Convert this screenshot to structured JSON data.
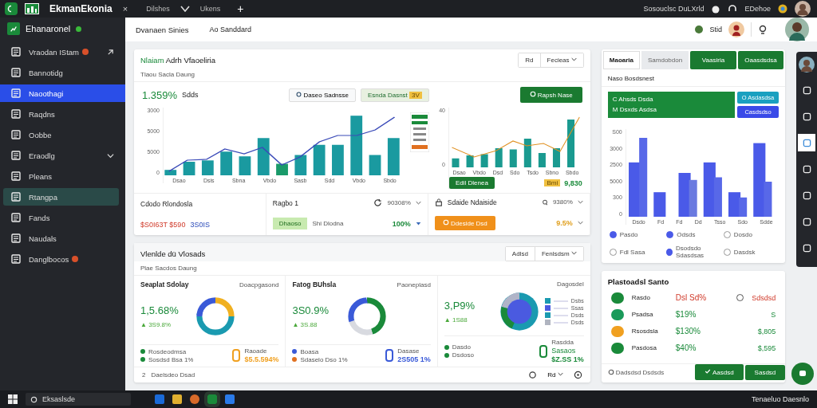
{
  "titlebar": {
    "tabs": [
      {
        "label": "EkmanEkonia",
        "selected": true
      },
      {
        "label": "Dilshes",
        "selected": false
      },
      {
        "label": "Ukens",
        "selected": false
      }
    ],
    "close": "×",
    "new_tab": "+",
    "status": "Sosouclsc DuLXrld",
    "user": "EDehoe"
  },
  "sidebar": {
    "title": "Ehanaronel",
    "items": [
      {
        "label": "Vraodan IStam",
        "badge": true,
        "link": true,
        "selected": false,
        "highlighted": false
      },
      {
        "label": "Bannotidg",
        "badge": false,
        "selected": false,
        "highlighted": false
      },
      {
        "label": "Naoothagi",
        "badge": false,
        "selected": true,
        "highlighted": false
      },
      {
        "label": "Raqdns",
        "badge": false,
        "selected": false,
        "highlighted": false
      },
      {
        "label": "Oobbe",
        "badge": false,
        "selected": false,
        "highlighted": false
      },
      {
        "label": "Eraodlg",
        "badge": false,
        "submenu": true,
        "selected": false,
        "highlighted": false
      },
      {
        "label": "Pleans",
        "badge": false,
        "selected": false,
        "highlighted": false
      },
      {
        "label": "Rtangpa",
        "badge": false,
        "selected": false,
        "highlighted": true
      },
      {
        "label": "Fands",
        "badge": false,
        "selected": false,
        "highlighted": false
      },
      {
        "label": "Naudals",
        "badge": false,
        "selected": false,
        "highlighted": false
      },
      {
        "label": "Danglbocos",
        "badge": true,
        "selected": false,
        "highlighted": false
      }
    ]
  },
  "header": {
    "title": "Dvanaen Sinies",
    "subtitle": "Ao Sanddard",
    "user": "Stid"
  },
  "overview": {
    "title_accent": "Nlaiam",
    "title": "Adrh Vfaoeliria",
    "subtitle": "Tlaou Sacla Daung",
    "filter": "Rd",
    "dropdown": "Fecieas",
    "stat": "1.359%",
    "stat_label": "Sdds",
    "chip_1": "Daseo Sadnsse",
    "chip_2": "Esnda Dasnst",
    "chip_2_tag": "3V",
    "action": "Rapsh Nase",
    "left_chart": {
      "y_labels": [
        "3000",
        "5000",
        "5000",
        "0"
      ],
      "x_labels": [
        "Dsao",
        "Dsis",
        "Sbna",
        "Vbdo",
        "Sasb",
        "Sdd",
        "Vbdo",
        "Sbdo"
      ]
    },
    "right_chart": {
      "y_labels": [
        "40",
        "0"
      ],
      "x_labels": [
        "Dsao",
        "Vbdo",
        "Dsd",
        "Sdo",
        "Tsdo",
        "Sbno",
        "Sbdo"
      ]
    },
    "chart_button": "Edil Dlenea",
    "chart_tag": "Bmi",
    "chart_total": "9,830",
    "cells": [
      {
        "title": "Cdodo Rlondosla",
        "value_1": "$S0I63T $590",
        "value_2": "3S0IS"
      },
      {
        "title": "Ragbo 1",
        "reading": "90308%",
        "chip": "Dhaoso",
        "note": "Shi Dlodna",
        "value": "100%"
      },
      {
        "title": "Sdaide Ndaiside",
        "reading": "9380%",
        "button": "Ddeside Dsd",
        "value": "9.5%"
      }
    ]
  },
  "breakdown": {
    "title": "Vlenlde dü Vlosads",
    "filter": "Adlsd",
    "dropdown": "Fenlsdsm",
    "subtitle": "Plae Sacdos Daung",
    "panels": [
      {
        "kind": "donut",
        "title": "Seaplat Sdolay",
        "note": "Doacpgasond",
        "value": "1,5.68%",
        "change": "▲ 3S9.8%",
        "legend": [
          {
            "label": "Rosdeodmsa",
            "color": "#1a8a3a"
          },
          {
            "label": "Sosdsd Bsa 1%",
            "color": "#1a8a3a"
          }
        ],
        "indicator": {
          "label": "Raoade",
          "value": "$5.5.594%",
          "color": "#f0a020"
        }
      },
      {
        "kind": "ring",
        "title": "Fatog BUhsla",
        "note": "Paoneplasd",
        "value": "3S0.9%",
        "change": "▲ 3S.88",
        "legend": [
          {
            "label": "Boasa",
            "color": "#3a5ad8"
          },
          {
            "label": "Sdaselo Dso 1%",
            "color": "#e07020"
          }
        ],
        "indicator": {
          "label": "Dasase",
          "value": "2S505 1%",
          "color": "#3a5ad8"
        }
      },
      {
        "kind": "pie",
        "note": "Dagosdel",
        "value": "3,P9%",
        "change": "▲ 1S88",
        "keys": [
          {
            "label": "Dsbs",
            "color": "#1a9ab0"
          },
          {
            "label": "Ssas",
            "color": "#4a5ae0"
          },
          {
            "label": "Dsds",
            "color": "#1a9ab0"
          },
          {
            "label": "Dsds",
            "color": "#b0b4c0"
          }
        ],
        "legend": [
          {
            "label": "Dasdo",
            "color": "#1a8a3a"
          },
          {
            "label": "Dsdoso",
            "color": "#1a8a3a"
          }
        ],
        "indicator": {
          "label": "Rasdda",
          "extra": "Sasaos",
          "value": "$Z.SS 1%",
          "color": "#1a8a3a"
        }
      }
    ],
    "footer": "Daelsdeo Dsad",
    "footer_count": "2",
    "footer_menu": "Rd"
  },
  "metrics": {
    "tabs": [
      {
        "label": "Maoaria",
        "selected": true
      },
      {
        "label": "Samdobdon",
        "selected": false
      }
    ],
    "buttons": [
      "Vaasiria",
      "Oaasdsdsa"
    ],
    "subtitle": "Naso Bosdsnest",
    "banner_1": "C Ahsds Dsda",
    "banner_2": "M Dsxds Asdsa",
    "button_a": "O Asdasdsa",
    "button_b": "Casdsdso",
    "y_labels": [
      "S00",
      "3000",
      "2500",
      "5000",
      "300",
      "0"
    ],
    "x_labels": [
      "Dsdo",
      "Fd",
      "Fd",
      "Dd",
      "Tsso",
      "Sdo",
      "Sdde"
    ],
    "legend": [
      {
        "label": "Pasdo",
        "checked": true
      },
      {
        "label": "Odsds",
        "checked": true
      },
      {
        "label": "Dosdo",
        "checked": false
      },
      {
        "label": "Fdl Sasa",
        "checked": false
      },
      {
        "label": "Dsodsdo Sdasdsas",
        "checked": true
      },
      {
        "label": "Dasdsk",
        "checked": false
      }
    ]
  },
  "positions": {
    "title": "Plastoadsl Santo",
    "rows": [
      {
        "name": "Rasdo",
        "change": "Dsl Sd%",
        "value": "Sdsdsd",
        "color": "#1a8a3a",
        "down": true
      },
      {
        "name": "Psadsa",
        "change": "$19%",
        "value": "S",
        "color": "#1a9a5a",
        "down": false
      },
      {
        "name": "Rsosdsla",
        "change": "$130%",
        "value": "$,805",
        "color": "#f0a020",
        "down": false
      },
      {
        "name": "Pasdosa",
        "change": "$40%",
        "value": "$,595",
        "color": "#1a8a3a",
        "down": false
      }
    ],
    "footer": "Dadsdsd Dsdsds",
    "confirm": "Aasdsd",
    "secondary": "Sasdsd"
  },
  "side_toolbar": [
    {
      "selected": false
    },
    {
      "selected": false
    },
    {
      "selected": true
    },
    {
      "selected": false
    },
    {
      "selected": false
    },
    {
      "selected": false
    },
    {
      "selected": false
    }
  ],
  "taskbar": {
    "placeholder": "Eksaslsde",
    "clock": "Tenaeluo Daesnlo"
  }
}
